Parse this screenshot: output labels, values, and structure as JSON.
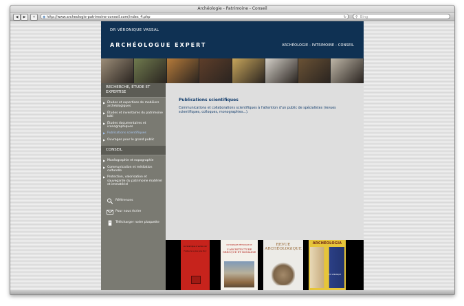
{
  "browser": {
    "window_title": "Archéologie - Patrimoine - Conseil",
    "url": "http://www.archeologie-patrimoine-conseil.com/index_4.php",
    "search_placeholder": "Bing",
    "back_glyph": "◀",
    "forward_glyph": "▶",
    "add_glyph": "+",
    "reload_glyph": "↻",
    "globe_glyph": "◉",
    "search_glyph": "⚲"
  },
  "header": {
    "name": "DR VÉRONIQUE VASSAL",
    "title": "ARCHÉOLOGUE EXPERT",
    "tagline": "ARCHÉOLOGIE - PATRIMOINE - CONSEIL"
  },
  "photo_strip": {
    "colors": [
      "#9c8d78",
      "#6f7a4e",
      "#b57a3a",
      "#5e3e2a",
      "#c7a55b",
      "#d4d0c8",
      "#6a5235",
      "#bfb7a8"
    ]
  },
  "sidebar": {
    "sections": [
      {
        "heading": "RECHERCHE, ÉTUDE ET EXPERTISE",
        "items": [
          {
            "label": "Études et expertises de mobiliers archéologiques"
          },
          {
            "label": "Études et inventaires du patrimoine bâti"
          },
          {
            "label": "Études documentaires et iconographiques"
          },
          {
            "label": "Publications scientifiques",
            "active": true
          },
          {
            "label": "Ouvrages pour le grand public"
          }
        ]
      },
      {
        "heading": "CONSEIL",
        "items": [
          {
            "label": "Muséographie et expographie"
          },
          {
            "label": "Communication et médiation culturelle"
          },
          {
            "label": "Protection, valorisation et sauvegarde du patrimoine matériel et immatériel"
          }
        ]
      }
    ],
    "links": [
      {
        "label": "Références",
        "icon": "magnifier-icon"
      },
      {
        "label": "Pour nous écrire",
        "icon": "envelope-icon"
      },
      {
        "label": "Télécharger notre plaquette",
        "icon": "document-icon"
      }
    ],
    "arrow_glyph": "▶"
  },
  "main": {
    "title": "Publications scientifiques",
    "description": "Communications et collaborations scientifiques à l'attention d'un public de spécialistes (revues scientifiques, colloques, monographies...)."
  },
  "books": [
    {
      "line1": "La céramique à vernis noir",
      "line2": "Fouilles de la place Jules Ferry"
    },
    {
      "line1": "DICTIONNAIRE MÉTHODIQUE DE",
      "line2": "L'ARCHITECTURE GRECQUE ET ROMAINE"
    },
    {
      "line1": "REVUE ARCHÉOLOGIQUE"
    },
    {
      "line1": "ARCHÉOLOGIA",
      "line2": "EYE VERONIQUE"
    }
  ]
}
